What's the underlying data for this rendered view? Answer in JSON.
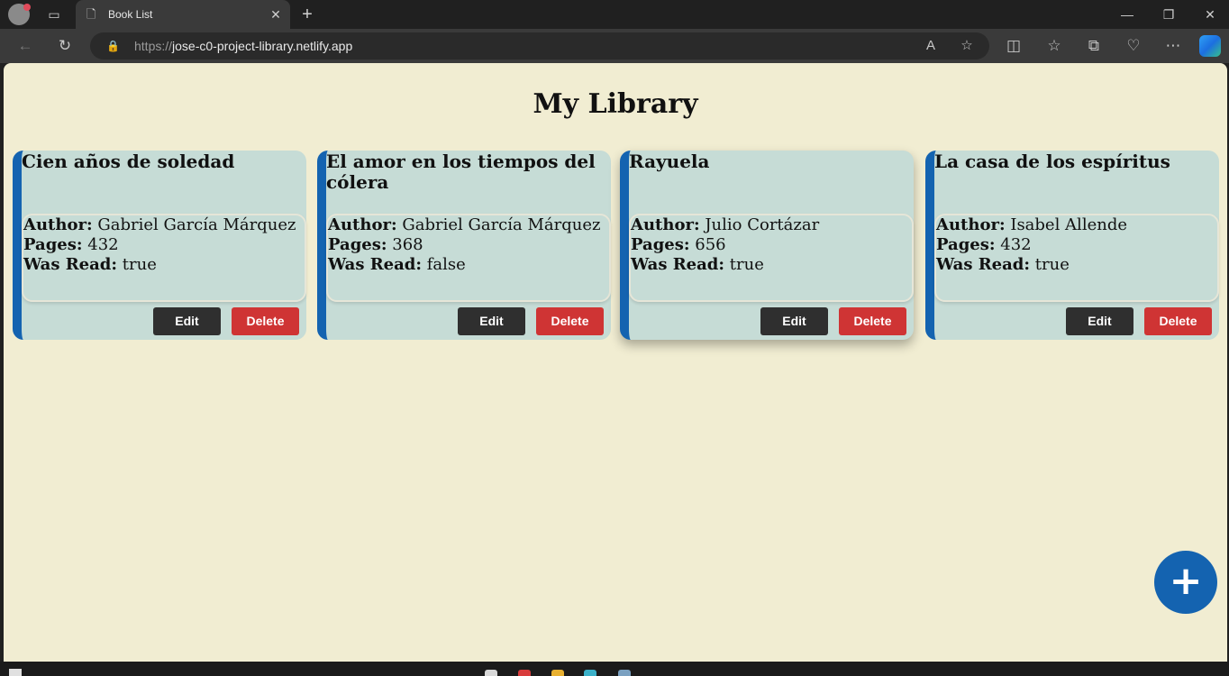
{
  "browser": {
    "tab_title": "Book List",
    "url_scheme": "https://",
    "url_host": "jose-c0-project-library.netlify.app",
    "icons": [
      "profile-icon",
      "tabs-icon",
      "page-icon",
      "close-icon",
      "plus-icon",
      "minimize-icon",
      "restore-icon",
      "close-window-icon",
      "back-icon",
      "refresh-icon",
      "lock-icon",
      "read-aloud-icon",
      "favorite-star-icon",
      "split-screen-icon",
      "favorites-icon",
      "collections-icon",
      "performance-icon",
      "more-icon",
      "copilot-icon"
    ]
  },
  "page": {
    "title": "My Library",
    "labels": {
      "author": "Author:",
      "pages": "Pages:",
      "read": "Was Read:"
    },
    "buttons": {
      "edit": "Edit",
      "delete": "Delete"
    },
    "fab_symbol": "+",
    "books": [
      {
        "title": "Cien años de soledad",
        "author": "Gabriel García Márquez",
        "pages": "432",
        "read": "true"
      },
      {
        "title": "El amor en los tiempos del cólera",
        "author": "Gabriel García Márquez",
        "pages": "368",
        "read": "false"
      },
      {
        "title": "Rayuela",
        "author": "Julio Cortázar",
        "pages": "656",
        "read": "true"
      },
      {
        "title": "La casa de los espíritus",
        "author": "Isabel Allende",
        "pages": "432",
        "read": "true"
      }
    ]
  },
  "colors": {
    "page_background": "#f1edd2",
    "card_background": "#c6dcd6",
    "card_accent": "#1463b0",
    "edit_button": "#2f2f2f",
    "delete_button": "#cf3434",
    "fab": "#1463b0"
  }
}
